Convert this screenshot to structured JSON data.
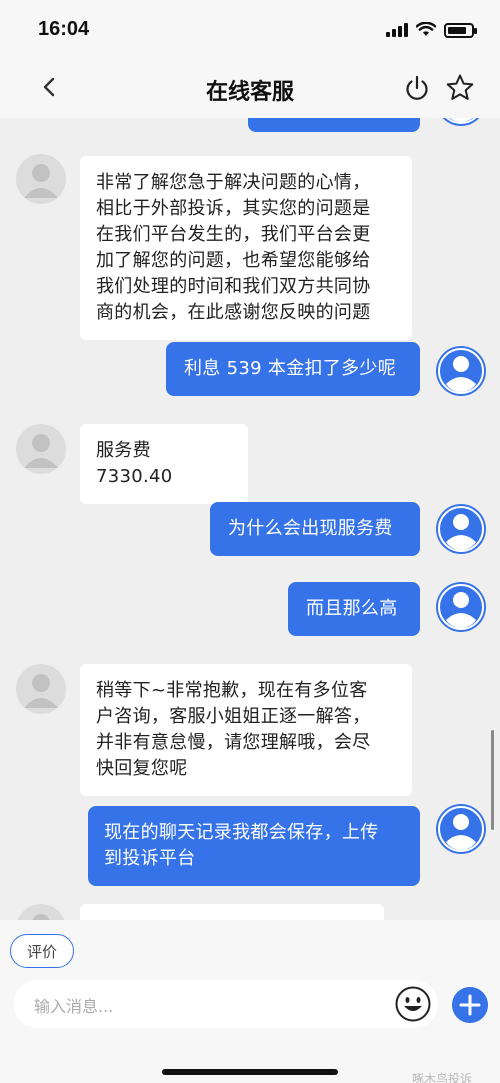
{
  "status_bar": {
    "time": "16:04"
  },
  "nav": {
    "title": "在线客服"
  },
  "messages": [
    {
      "side": "left",
      "lines": [
        "非常了解您急于解决问题的心情，",
        "相比于外部投诉，其实您的问题是",
        "在我们平台发生的，我们平台会更",
        "加了解您的问题，也希望您能够给",
        "我们处理的时间和我们双方共同协",
        "商的机会，在此感谢您反映的问题"
      ]
    },
    {
      "side": "right",
      "lines": [
        "利息 539 本金扣了多少呢"
      ]
    },
    {
      "side": "left",
      "lines": [
        "服务费 7330.40"
      ]
    },
    {
      "side": "right",
      "lines": [
        "为什么会出现服务费"
      ]
    },
    {
      "side": "right",
      "lines": [
        "而且那么高"
      ]
    },
    {
      "side": "left",
      "lines": [
        "稍等下~非常抱歉，现在有多位客",
        "户咨询，客服小姐姐正逐一解答，",
        "并非有意怠慢，请您理解哦，会尽",
        "快回复您呢"
      ]
    },
    {
      "side": "right",
      "lines": [
        "现在的聊天记录我都会保存，上传",
        "到投诉平台"
      ]
    }
  ],
  "bottom_bar": {
    "rate_label": "评价",
    "input_placeholder": "输入消息..."
  },
  "watermark": "啄木鸟投诉",
  "colors": {
    "accent": "#3673e8",
    "background": "#efefef",
    "bar": "#f7f7f7"
  },
  "icons": [
    "back-icon",
    "power-icon",
    "star-icon",
    "user-avatar-icon",
    "emoji-icon",
    "plus-icon"
  ]
}
